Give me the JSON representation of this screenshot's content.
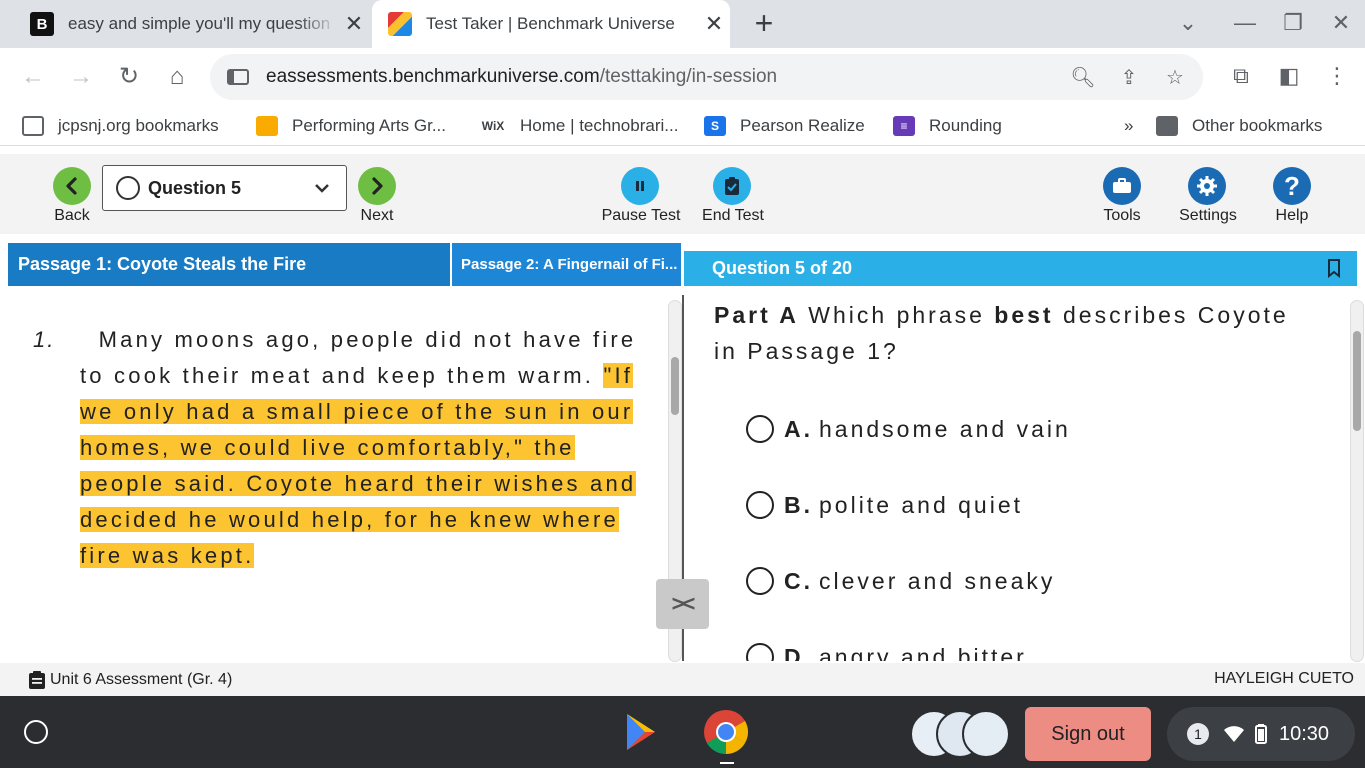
{
  "browser": {
    "tabs": [
      {
        "title": "easy and simple you'll my question",
        "close": "✕"
      },
      {
        "title": "Test Taker | Benchmark Universe",
        "close": "✕"
      }
    ],
    "new_tab": "+",
    "url_host": "eassessments.benchmarkuniverse.com",
    "url_path": "/testtaking/in-session",
    "bookmarks": [
      {
        "label": "jcpsnj.org bookmarks"
      },
      {
        "label": "Performing Arts Gr..."
      },
      {
        "label": "Home | technobrari...",
        "icon_text": "WiX"
      },
      {
        "label": "Pearson Realize"
      },
      {
        "label": "Rounding"
      }
    ],
    "bookmarks_overflow": "»",
    "other_bookmarks": "Other bookmarks"
  },
  "app": {
    "back_label": "Back",
    "next_label": "Next",
    "question_select": "Question 5",
    "pause_label": "Pause Test",
    "end_label": "End Test",
    "tools_label": "Tools",
    "settings_label": "Settings",
    "help_label": "Help",
    "help_glyph": "?",
    "passage_tabs": [
      "Passage 1: Coyote Steals the Fire",
      "Passage 2: A Fingernail of Fi..."
    ],
    "question_header": "Question 5 of 20",
    "colors": {
      "accent_green": "#6fbe44",
      "accent_blue": "#1a7bc5",
      "question_blue": "#2ab0e6",
      "highlight": "#fdc431"
    }
  },
  "passage": {
    "paragraph_number": "1.",
    "text_plain": "  Many moons ago, people did not have fire to cook their meat and keep them warm. ",
    "text_highlight": "\"If we only had a small piece of the sun in our homes, we could live comfortably,\" the people said. Coyote heard their wishes and decided he would help, for he knew where fire was kept."
  },
  "question": {
    "part": "Part A",
    "prompt_before": "Which phrase",
    "prompt_bold": "best",
    "prompt_after": "describes Coyote in Passage 1?",
    "options": [
      {
        "letter": "A.",
        "text": "handsome and vain"
      },
      {
        "letter": "B.",
        "text": "polite and quiet"
      },
      {
        "letter": "C.",
        "text": "clever and sneaky"
      },
      {
        "letter": "D.",
        "text": "angry and bitter"
      }
    ]
  },
  "status": {
    "assessment": "Unit 6 Assessment (Gr. 4)",
    "student": "HAYLEIGH CUETO"
  },
  "shelf": {
    "sign_out": "Sign out",
    "notification_count": "1",
    "time": "10:30"
  }
}
